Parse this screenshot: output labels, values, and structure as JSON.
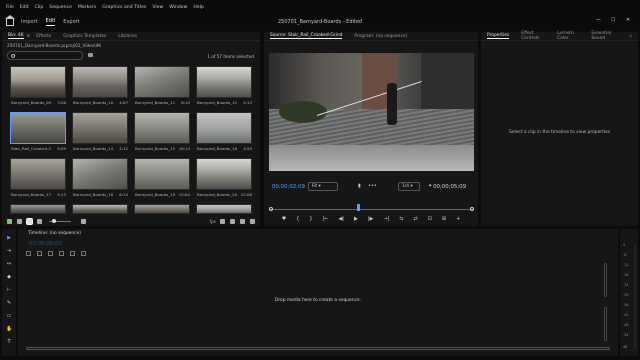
{
  "menubar": {
    "items": [
      "File",
      "Edit",
      "Clip",
      "Sequence",
      "Markers",
      "Graphics and Titles",
      "View",
      "Window",
      "Help"
    ]
  },
  "workspace": {
    "tabs": [
      "Import",
      "Edit",
      "Export"
    ],
    "active_tab": "Edit",
    "document_title": "250701_Barnyard-Boards - Edited"
  },
  "window_controls": {
    "minimize": "—",
    "maximize": "☐",
    "close": "✕"
  },
  "project_panel": {
    "tabs": [
      "Bin: 4K",
      "Effects",
      "Graphics Templates",
      "Libraries"
    ],
    "tab_menu": "≡",
    "path": "250701_Barnyard-Boards.prproj\\02_Video\\4K",
    "search_placeholder": "",
    "items_count": "1 of 57 items selected",
    "clips": [
      {
        "name": "Barnyard_Boards_09...",
        "duration": "3:08"
      },
      {
        "name": "Barnyard_Boards_10...",
        "duration": "4:07"
      },
      {
        "name": "Barnyard_Boards_11...",
        "duration": "6:10"
      },
      {
        "name": "Barnyard_Boards_12...",
        "duration": "4:13"
      },
      {
        "name": "Stair_Rail_Crooked-Gr...",
        "duration": "5:09"
      },
      {
        "name": "Barnyard_Boards_14...",
        "duration": "4:12"
      },
      {
        "name": "Barnyard_Boards_15...",
        "duration": "16:13"
      },
      {
        "name": "Barnyard_Boards_16...",
        "duration": "4:20"
      },
      {
        "name": "Barnyard_Boards_17...",
        "duration": "5:13"
      },
      {
        "name": "Barnyard_Boards_18...",
        "duration": "6:14"
      },
      {
        "name": "Barnyard_Boards_19...",
        "duration": "15:04"
      },
      {
        "name": "Barnyard_Boards_20...",
        "duration": "12:06"
      }
    ],
    "selected_index": 4,
    "toolbar_right": "fps"
  },
  "source_panel": {
    "tabs": [
      "Source: Stair_Rail_Crooked-Grind",
      "Program: (no sequence)"
    ],
    "timecode_left": "00;00;02;09",
    "fit_label": "Fit",
    "resolution": "1/4",
    "timecode_right": "00;00;05;09",
    "transport": [
      "♥",
      "{",
      "}",
      "|←",
      "◀|",
      "▶",
      "|▶",
      "→|",
      "⇆",
      "⇄",
      "⊡",
      "⊞",
      "+"
    ]
  },
  "properties_panel": {
    "tabs": [
      "Properties",
      "Effect Controls",
      "Lumetri Color",
      "Essential Sound"
    ],
    "overflow": "»",
    "message": "Select a clip in the timeline to view properties"
  },
  "timeline_panel": {
    "title": "Timeline: (no sequence)",
    "timecode": "00;00;00;00",
    "drop_message": "Drop media here to create a sequence."
  },
  "audio_meter": {
    "labels": [
      "0",
      "-6",
      "-12",
      "-18",
      "-24",
      "-30",
      "-36",
      "-42",
      "-48",
      "-54",
      "dB"
    ]
  },
  "tools": [
    "▶",
    "⇥",
    "↔",
    "◆",
    "⊢",
    "✎",
    "▭",
    "✋",
    "T"
  ]
}
